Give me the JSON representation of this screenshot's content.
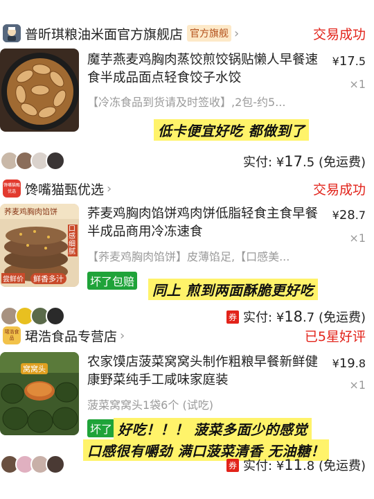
{
  "orders": [
    {
      "shop": "普昕琪粮油米面官方旗舰店",
      "shop_tag": "官方旗舰",
      "status": "交易成功",
      "title": "魔芋燕麦鸡胸肉蒸饺煎饺锅贴懒人早餐速食半成品面点轻食饺子水饺",
      "sku": "【冷冻食品到货请及时签收】,2包-约5...",
      "price_symbol": "¥",
      "price_int": "17",
      "price_dec": ".5",
      "qty": "×1",
      "overlay": "低卡便宜好吃 都做到了",
      "pay_label": "实付: ",
      "pay_symbol": "¥",
      "pay_int": "17",
      "pay_dec": ".5",
      "pay_note": "(免运费)"
    },
    {
      "shop": "馋嘴猫甄优选",
      "shop_logo_text": "馋嘴猫甄优选",
      "status": "交易成功",
      "title": "荞麦鸡胸肉馅饼鸡肉饼低脂轻食主食早餐半成品商用冷冻速食",
      "sku": "【荞麦鸡胸肉馅饼】皮薄馅足,【口感美...",
      "refund_tag": "坏了包赔",
      "price_symbol": "¥",
      "price_int": "28",
      "price_dec": ".7",
      "qty": "×1",
      "overlay": "同上 煎到两面酥脆更好吃",
      "img_text_1": "荞麦鸡胸肉馅饼",
      "img_text_2": "鲜香多汁",
      "img_text_3": "口感细腻",
      "img_text_4": "尝鲜价",
      "coupon": "券",
      "pay_label": "实付: ",
      "pay_symbol": "¥",
      "pay_int": "18",
      "pay_dec": ".7",
      "pay_note": "(免运费)"
    },
    {
      "shop": "珺浩食品专营店",
      "shop_logo_text": "珺浩食品",
      "status": "已5星好评",
      "title": "农家馍店菠菜窝窝头制作粗粮早餐新鲜健康野菜纯手工咸味家庭装",
      "sku": "菠菜窝窝头1袋6个 (试吃)",
      "refund_tag": "坏了",
      "price_symbol": "¥",
      "price_int": "19",
      "price_dec": ".8",
      "qty": "×1",
      "overlay_1": "好吃！！！ 菠菜多面少的感觉",
      "overlay_2": "口感很有嚼劲 满口菠菜清香 无油糖！",
      "img_text_1": "窝窝头",
      "coupon": "券",
      "pay_label": "实付: ",
      "pay_symbol": "¥",
      "pay_int": "11",
      "pay_dec": ".8",
      "pay_note": "(免运费)"
    }
  ],
  "colors": {
    "status_red": "#e2231a",
    "overlay_yellow": "#fff36a",
    "refund_green": "#1fa339"
  }
}
